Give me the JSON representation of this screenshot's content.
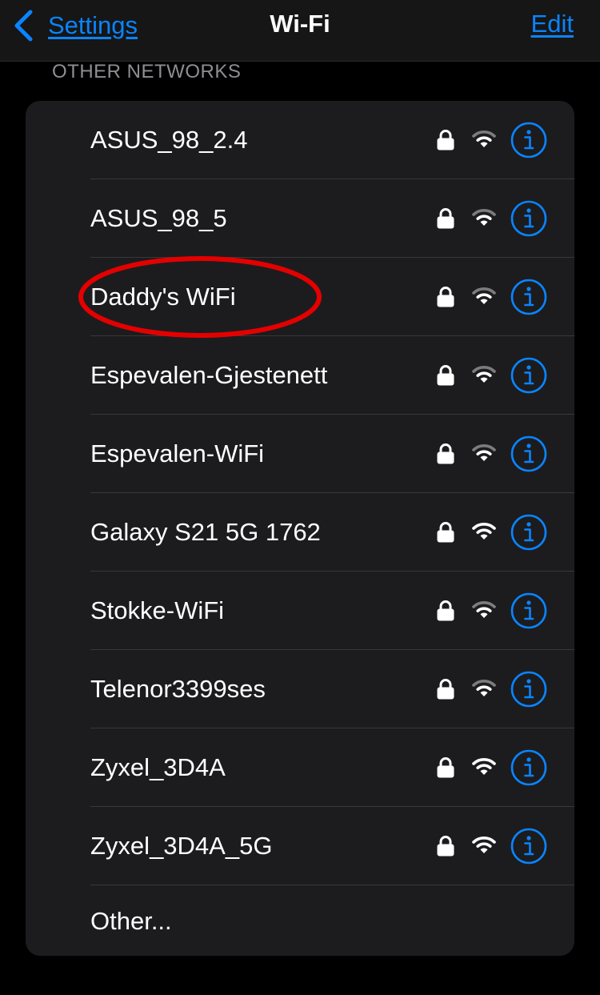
{
  "navbar": {
    "back_label": "Settings",
    "title": "Wi-Fi",
    "edit_label": "Edit"
  },
  "section": {
    "header": "OTHER NETWORKS"
  },
  "networks": [
    {
      "name": "ASUS_98_2.4",
      "secured": true,
      "signal_bars": 2,
      "signal_max": 3
    },
    {
      "name": "ASUS_98_5",
      "secured": true,
      "signal_bars": 2,
      "signal_max": 3
    },
    {
      "name": "Daddy's WiFi",
      "secured": true,
      "signal_bars": 2,
      "signal_max": 3
    },
    {
      "name": "Espevalen-Gjestenett",
      "secured": true,
      "signal_bars": 2,
      "signal_max": 3
    },
    {
      "name": "Espevalen-WiFi",
      "secured": true,
      "signal_bars": 2,
      "signal_max": 3
    },
    {
      "name": "Galaxy S21 5G 1762",
      "secured": true,
      "signal_bars": 3,
      "signal_max": 3
    },
    {
      "name": "Stokke-WiFi",
      "secured": true,
      "signal_bars": 2,
      "signal_max": 3
    },
    {
      "name": "Telenor3399ses",
      "secured": true,
      "signal_bars": 2,
      "signal_max": 3
    },
    {
      "name": "Zyxel_3D4A",
      "secured": true,
      "signal_bars": 3,
      "signal_max": 3
    },
    {
      "name": "Zyxel_3D4A_5G",
      "secured": true,
      "signal_bars": 3,
      "signal_max": 3
    }
  ],
  "other_label": "Other...",
  "icons": {
    "back": "chevron-left-icon",
    "lock": "lock-icon",
    "wifi": "wifi-signal-icon",
    "info": "info-icon"
  },
  "colors": {
    "accent": "#0a84ff",
    "background": "#000000",
    "group_background": "#1c1c1e",
    "navbar_background": "#161616",
    "separator": "#38383a",
    "secondary_text": "#8e8e93",
    "highlight_annotation": "#e40000",
    "wifi_active": "#ffffff",
    "wifi_inactive": "#7c7c80"
  },
  "annotation": {
    "highlighted_network": "Daddy's WiFi"
  }
}
